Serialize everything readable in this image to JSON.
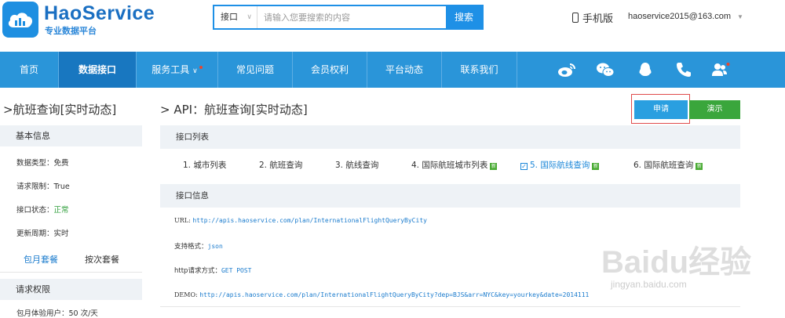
{
  "brand": {
    "name": "HaoService",
    "tagline": "专业数据平台"
  },
  "search": {
    "category": "接口",
    "placeholder": "请输入您要搜索的内容",
    "button": "搜索"
  },
  "header": {
    "mobile_label": "手机版",
    "account": "haoservice2015@163.com"
  },
  "nav": {
    "items": [
      {
        "label": "首页"
      },
      {
        "label": "数据接口",
        "active": true
      },
      {
        "label": "服务工具"
      },
      {
        "label": "常见问题"
      },
      {
        "label": "会员权利"
      },
      {
        "label": "平台动态"
      },
      {
        "label": "联系我们"
      }
    ],
    "icons": [
      "weibo-icon",
      "wechat-icon",
      "qq-icon",
      "phone-icon",
      "users-icon"
    ]
  },
  "sidebar": {
    "title": ">航班查询[实时动态]",
    "basic_info_head": "基本信息",
    "rows": [
      {
        "label": "数据类型：",
        "value": "免费"
      },
      {
        "label": "请求限制：",
        "value": "True"
      },
      {
        "label": "接口状态：",
        "value": "正常"
      },
      {
        "label": "更新周期：",
        "value": "实时"
      }
    ],
    "tabs": [
      "包月套餐",
      "按次套餐"
    ],
    "perm_head": "请求权限",
    "partial_row": "包月体验用户：50 次/天"
  },
  "main": {
    "title": "> API：航班查询[实时动态]",
    "apply_button": "申请",
    "demo_button": "演示",
    "list_head": "接口列表",
    "api_list": [
      {
        "label": "1. 城市列表",
        "new": false,
        "selected": false
      },
      {
        "label": "2. 航班查询",
        "new": false,
        "selected": false
      },
      {
        "label": "3. 航线查询",
        "new": false,
        "selected": false
      },
      {
        "label": "4. 国际航班城市列表",
        "new": true,
        "selected": false
      },
      {
        "label": "5. 国际航线查询",
        "new": true,
        "selected": true
      },
      {
        "label": "6. 国际航班查询",
        "new": true,
        "selected": false
      }
    ],
    "new_badge": "新",
    "info_head": "接口信息",
    "info": {
      "url_label": "URL:",
      "url": "http://apis.haoservice.com/plan/InternationalFlightQueryByCity",
      "format_label": "支持格式：",
      "format": "json",
      "method_label": "http请求方式：",
      "method": "GET POST",
      "demo_label": "DEMO:",
      "demo": "http://apis.haoservice.com/plan/InternationalFlightQueryByCity?dep=BJS&arr=NYC&key=yourkey&date=2014111"
    }
  },
  "watermark": {
    "text": "Baidu经验",
    "url": "jingyan.baidu.com"
  }
}
